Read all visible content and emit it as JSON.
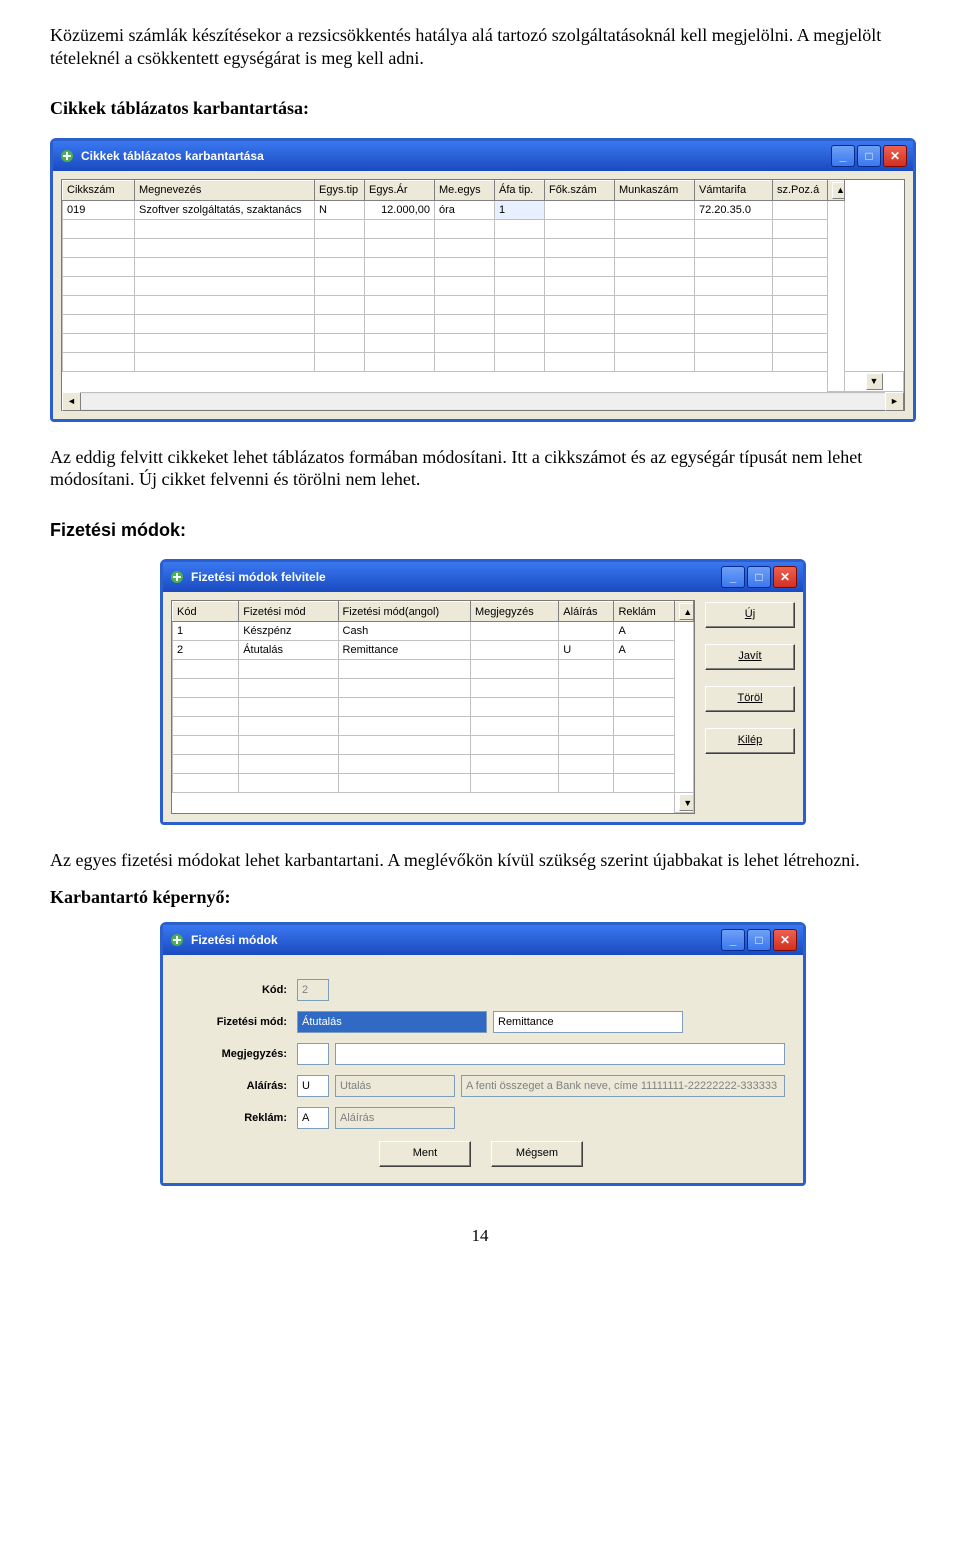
{
  "para1": "Közüzemi számlák készítésekor a rezsicsökkentés hatálya alá tartozó szolgáltatásoknál kell megjelölni. A megjelölt tételeknél a csökkentett egységárat is meg kell adni.",
  "section1_title": "Cikkek táblázatos karbantartása:",
  "section1_para": "Az eddig felvitt cikkeket lehet táblázatos formában módosítani. Itt a cikkszámot és az egységár típusát nem lehet módosítani. Új cikket felvenni és törölni nem lehet.",
  "section2_title": "Fizetési módok:",
  "section2_para": "Az egyes fizetési módokat lehet karbantartani. A meglévőkön kívül szükség szerint újabbakat is lehet létrehozni.",
  "section3_title": "Karbantartó képernyő:",
  "page_number": "14",
  "w1": {
    "title": "Cikkek táblázatos karbantartása",
    "headers": {
      "cikkszam": "Cikkszám",
      "megnevezes": "Megnevezés",
      "egystip": "Egys.tip",
      "egysar": "Egys.Ár",
      "me": "Me.egys",
      "afatip": "Áfa tip.",
      "fokszam": "Fők.szám",
      "munkaszam": "Munkaszám",
      "vamtarifa": "Vámtarifa",
      "szpoz": "sz.Poz.á"
    },
    "row": {
      "cikkszam": "019",
      "megnevezes": "Szoftver szolgáltatás, szaktanács",
      "egystip": "N",
      "egysar": "12.000,00",
      "me": "óra",
      "afatip": "1",
      "fokszam": "",
      "munkaszam": "",
      "vamtarifa": "72.20.35.0",
      "szpoz": ""
    }
  },
  "w2": {
    "title": "Fizetési módok felvitele",
    "headers": {
      "kod": "Kód",
      "fizmod": "Fizetési mód",
      "fizmod_en": "Fizetési mód(angol)",
      "megj": "Megjegyzés",
      "alairas": "Aláírás",
      "reklam": "Reklám"
    },
    "rows": [
      {
        "kod": "1",
        "fizmod": "Készpénz",
        "fizmod_en": "Cash",
        "megj": "",
        "alairas": "",
        "reklam": "A"
      },
      {
        "kod": "2",
        "fizmod": "Átutalás",
        "fizmod_en": "Remittance",
        "megj": "",
        "alairas": "U",
        "reklam": "A"
      }
    ],
    "buttons": {
      "uj": "Új",
      "javit": "Javít",
      "torol": "Töröl",
      "kilep": "Kilép"
    }
  },
  "w3": {
    "title": "Fizetési módok",
    "labels": {
      "kod": "Kód:",
      "fizmod": "Fizetési mód:",
      "megj": "Megjegyzés:",
      "alairas": "Aláírás:",
      "reklam": "Reklám:"
    },
    "values": {
      "kod": "2",
      "fizmod_hu": "Átutalás",
      "fizmod_en": "Remittance",
      "megj": "",
      "alairas_code": "U",
      "alairas_text": "Utalás",
      "alairas_hint": "A fenti összeget a Bank neve, címe 11111111-22222222-333333",
      "reklam_code": "A",
      "reklam_text": "Aláírás"
    },
    "buttons": {
      "ment": "Ment",
      "megsem": "Mégsem"
    }
  }
}
